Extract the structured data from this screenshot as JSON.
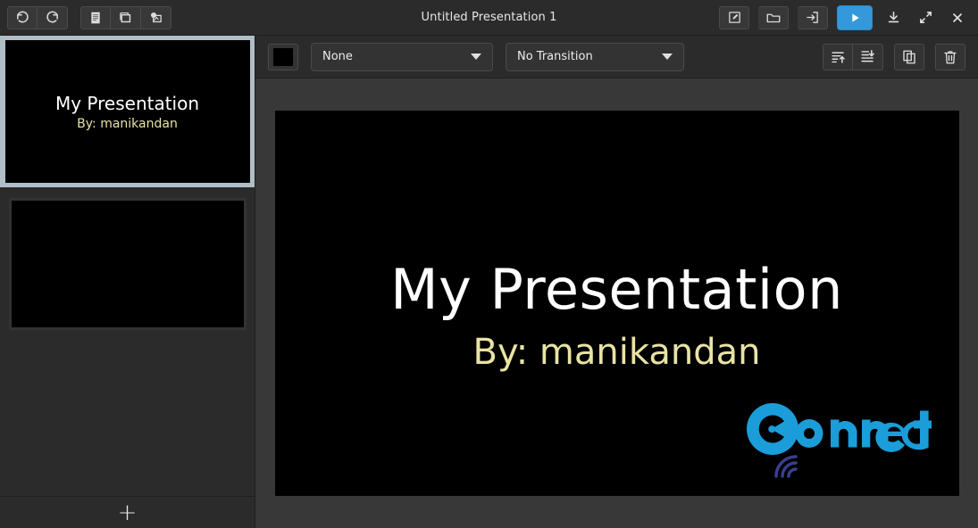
{
  "window": {
    "title": "Untitled Presentation 1"
  },
  "titlebar": {
    "left_buttons": [
      {
        "name": "undo-button",
        "icon": "undo-icon",
        "label": "Undo"
      },
      {
        "name": "redo-button",
        "icon": "redo-icon",
        "label": "Redo"
      },
      {
        "name": "new-slide-button",
        "icon": "document-icon",
        "label": "New Slide"
      },
      {
        "name": "layout-button",
        "icon": "layout-icon",
        "label": "Slide Layout"
      },
      {
        "name": "image-button",
        "icon": "image-icon",
        "label": "Insert Image"
      }
    ],
    "right_buttons": [
      {
        "name": "edit-button",
        "icon": "pencil-square-icon",
        "label": "Edit"
      },
      {
        "name": "open-button",
        "icon": "folder-icon",
        "label": "Open"
      },
      {
        "name": "export-button",
        "icon": "export-icon",
        "label": "Export"
      },
      {
        "name": "play-button",
        "icon": "play-icon",
        "label": "Play Presentation"
      },
      {
        "name": "download-button",
        "icon": "download-icon",
        "label": "Download"
      },
      {
        "name": "fullscreen-button",
        "icon": "expand-icon",
        "label": "Fullscreen"
      },
      {
        "name": "close-button",
        "icon": "close-icon",
        "label": "Close"
      }
    ],
    "accent_color": "#3498db"
  },
  "subtoolbar": {
    "color_swatch": {
      "label": "Background Color",
      "value": "#000000"
    },
    "animation": {
      "label": "None",
      "name": "animation-select"
    },
    "transition": {
      "label": "No Transition",
      "name": "transition-select"
    },
    "right_buttons": [
      {
        "name": "move-slide-up-button",
        "icon": "list-arrow-up-icon",
        "label": "Move Up"
      },
      {
        "name": "move-slide-down-button",
        "icon": "list-arrow-down-icon",
        "label": "Move Down"
      },
      {
        "name": "duplicate-slide-button",
        "icon": "copy-icon",
        "label": "Duplicate Slide"
      },
      {
        "name": "delete-slide-button",
        "icon": "trash-icon",
        "label": "Delete Slide"
      }
    ]
  },
  "sidebar": {
    "selection_border_color": "#b0bec8",
    "add_slide_label": "+",
    "slides": [
      {
        "index": 1,
        "selected": true,
        "title": "My Presentation",
        "subtitle": "By: manikandan",
        "background": "#000000"
      },
      {
        "index": 2,
        "selected": false,
        "title": "",
        "subtitle": "",
        "background": "#000000"
      }
    ]
  },
  "slide_canvas": {
    "background": "#000000",
    "title": "My Presentation",
    "title_color": "#ffffff",
    "subtitle": "By: manikandan",
    "subtitle_color": "#e9e3a4",
    "logo": {
      "name": "connect-logo",
      "text": "Connect",
      "primary_color": "#1b9dd9",
      "arc_color": "#3b3f8f"
    }
  }
}
